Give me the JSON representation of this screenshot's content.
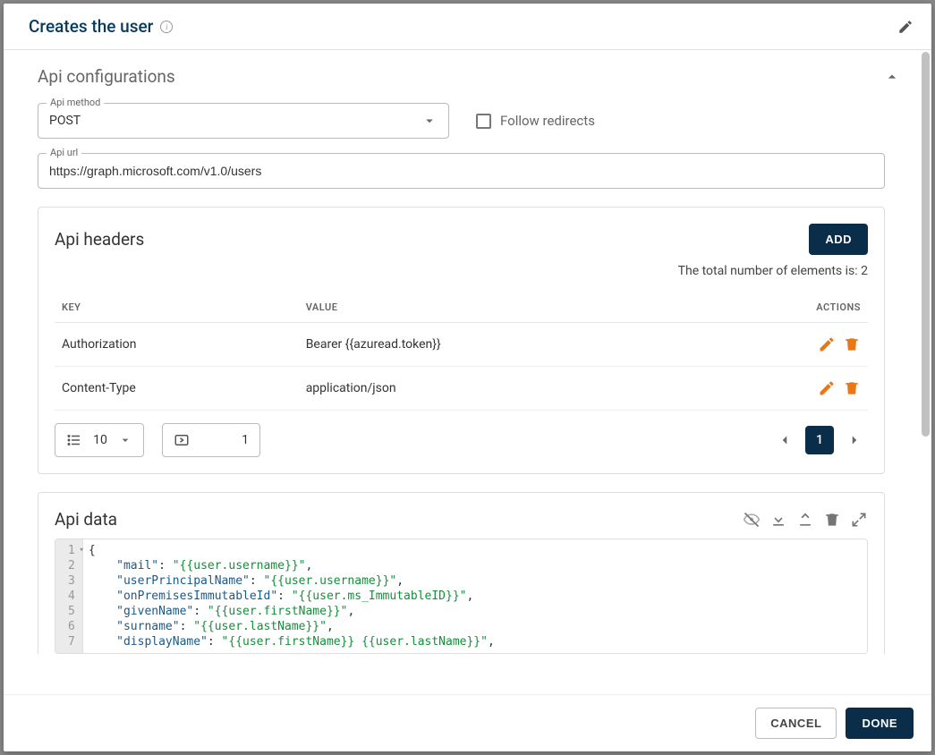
{
  "header": {
    "title": "Creates the user"
  },
  "section": {
    "title": "Api configurations"
  },
  "apiMethod": {
    "label": "Api method",
    "value": "POST"
  },
  "followRedirects": {
    "label": "Follow redirects",
    "checked": false
  },
  "apiUrl": {
    "label": "Api url",
    "value": "https://graph.microsoft.com/v1.0/users"
  },
  "headersCard": {
    "title": "Api headers",
    "addLabel": "ADD",
    "totalText": "The total number of elements is: 2",
    "columns": {
      "key": "KEY",
      "value": "VALUE",
      "actions": "ACTIONS"
    },
    "rows": [
      {
        "key": "Authorization",
        "value": "Bearer {{azuread.token}}"
      },
      {
        "key": "Content-Type",
        "value": "application/json"
      }
    ],
    "pageSize": "10",
    "gotoPage": "1",
    "currentPage": "1"
  },
  "dataCard": {
    "title": "Api data",
    "code": {
      "lines": [
        {
          "n": "1",
          "raw": "{"
        },
        {
          "n": "2",
          "key": "mail",
          "val": "{{user.username}}"
        },
        {
          "n": "3",
          "key": "userPrincipalName",
          "val": "{{user.username}}"
        },
        {
          "n": "4",
          "key": "onPremisesImmutableId",
          "val": "{{user.ms_ImmutableID}}"
        },
        {
          "n": "5",
          "key": "givenName",
          "val": "{{user.firstName}}"
        },
        {
          "n": "6",
          "key": "surname",
          "val": "{{user.lastName}}"
        },
        {
          "n": "7",
          "key": "displayName",
          "val": "{{user.firstName}} {{user.lastName}}"
        }
      ]
    }
  },
  "footer": {
    "cancel": "CANCEL",
    "done": "DONE"
  }
}
